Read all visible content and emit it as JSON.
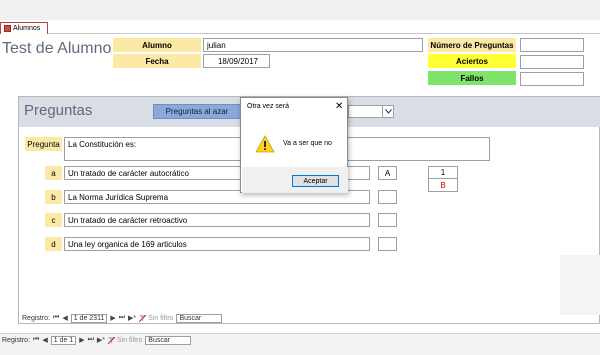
{
  "tab": {
    "label": "Alumnos",
    "icon": "form-icon"
  },
  "form": {
    "title": "Test de Alumno",
    "alumno_label": "Alumno",
    "alumno_value": "julian",
    "fecha_label": "Fecha",
    "fecha_value": "18/09/2017",
    "num_preguntas_label": "Número de Preguntas",
    "num_preguntas_value": "",
    "aciertos_label": "Aciertos",
    "aciertos_value": "",
    "fallos_label": "Fallos",
    "fallos_value": ""
  },
  "subform": {
    "title": "Preguntas",
    "random_button": "Preguntas al azar",
    "combo_value": "",
    "pregunta_label": "Pregunta",
    "pregunta_text": "La Constitución es:",
    "options": [
      {
        "letter": "a",
        "text": "Un tratado de carácter autocrático",
        "answer": "A"
      },
      {
        "letter": "b",
        "text": "La Norma Jurídica Suprema",
        "answer": ""
      },
      {
        "letter": "c",
        "text": "Un tratado de carácter retroactivo",
        "answer": ""
      },
      {
        "letter": "d",
        "text": "Una ley organica de 169 articulos",
        "answer": ""
      }
    ],
    "result_number": "1",
    "result_letter": "B"
  },
  "inner_nav": {
    "label": "Registro:",
    "first": "⏮",
    "prev": "◀",
    "position": "1 de 2311",
    "next": "▶",
    "last": "⏭",
    "new": "▶*",
    "filter": "Sin filtro",
    "search": "Buscar"
  },
  "outer_nav": {
    "label": "Registro:",
    "first": "⏮",
    "prev": "◀",
    "position": "1 de 1",
    "next": "▶",
    "last": "⏭",
    "new": "▶*",
    "filter": "Sin filtro",
    "search": "Buscar"
  },
  "dialog": {
    "title": "Otra vez será",
    "close": "✕",
    "message": "Va a ser que no",
    "button": "Aceptar",
    "icon": "warning-icon"
  },
  "colors": {
    "label_yellow": "#fce9a6",
    "aciertos_yellow": "#ffff33",
    "fallos_green": "#7ee36b",
    "button_blue": "#8aa9d8",
    "result_red": "#d00000"
  }
}
